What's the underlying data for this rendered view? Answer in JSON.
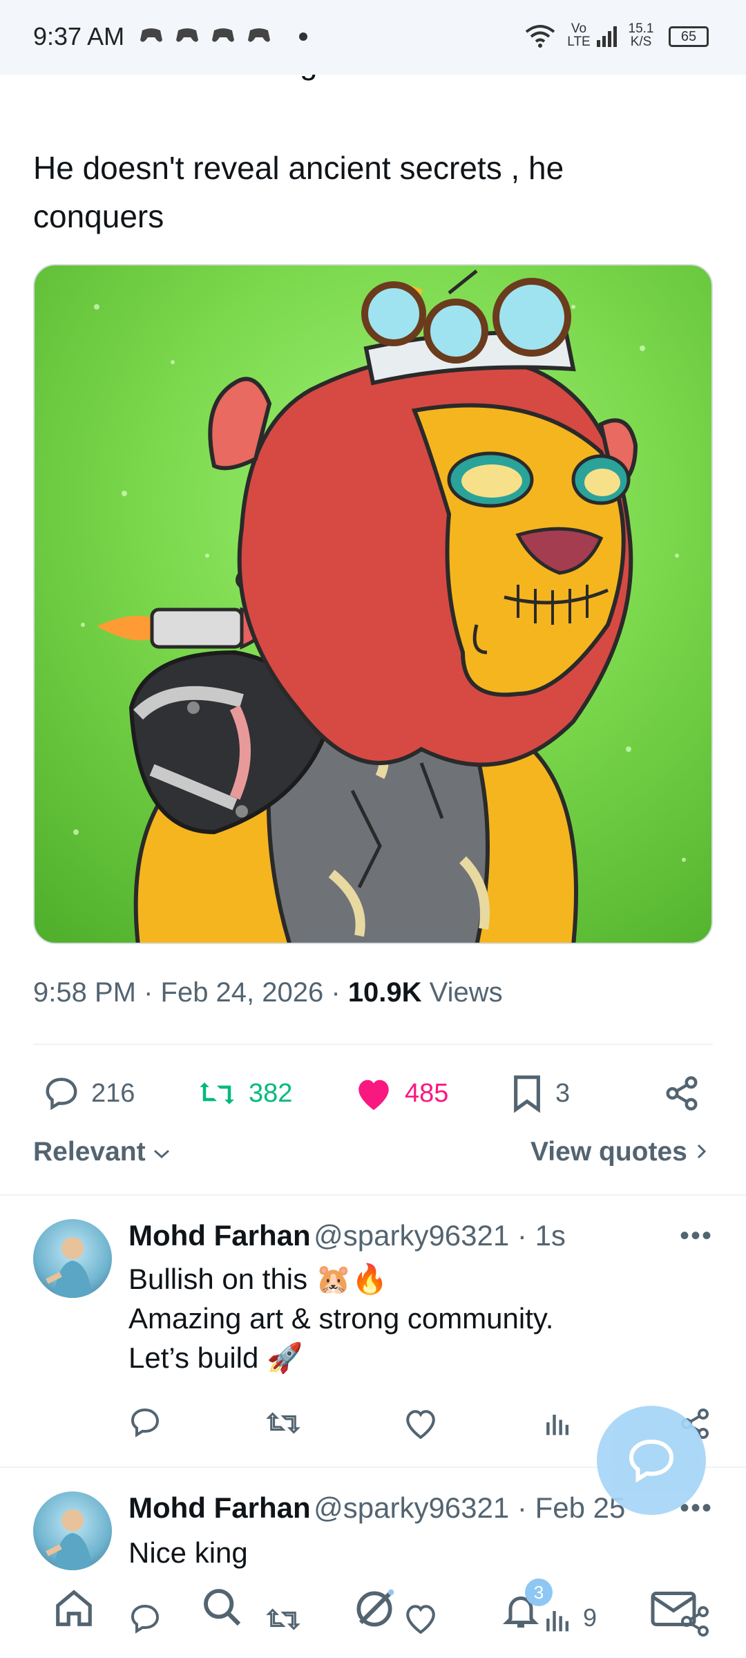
{
  "status_bar": {
    "time": "9:37 AM",
    "network": "Vo LTE",
    "speed": "15.1 K/S",
    "battery": "65"
  },
  "tweet": {
    "cut_text": "armor hides the forge of futures.",
    "text_line1": "He doesn't reveal ancient secrets , he",
    "text_line2": "conquers",
    "time": "9:58 PM · Feb 24, 2026 · ",
    "views_count": "10.9K",
    "views_label": " Views",
    "replies": "216",
    "reposts": "382",
    "likes": "485",
    "bookmarks": "3",
    "colors": {
      "repost": "#00ba7c",
      "like": "#f91880"
    }
  },
  "sort": {
    "label": "Relevant",
    "view_quotes": "View quotes"
  },
  "replies": [
    {
      "name": "Mohd Farhan",
      "handle": "@sparky96321 · 1s",
      "line1": "Bullish on this 🐹🔥",
      "line2": "Amazing art & strong community.",
      "line3": "Let’s build 🚀"
    },
    {
      "name": "Mohd Farhan",
      "handle": "@sparky96321 · Feb 25",
      "line1": "Nice king"
    }
  ],
  "bottom_nav": {
    "notification_badge": "3",
    "views_count": "9"
  }
}
